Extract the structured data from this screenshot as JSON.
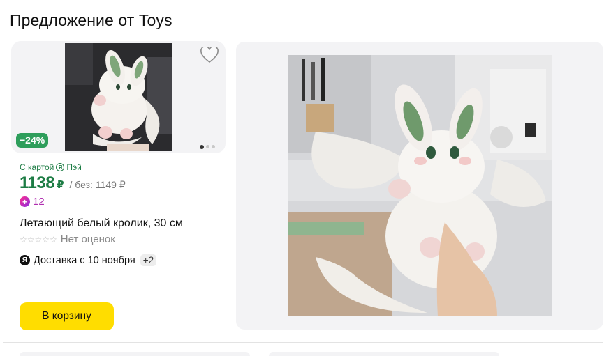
{
  "section": {
    "title": "Предложение от Toys"
  },
  "card": {
    "discount_badge": "−24%",
    "pay_label": "С картой",
    "pay_brand_mark": "Я",
    "pay_brand": "Пэй",
    "price": "1138",
    "currency": "₽",
    "old_price": "/ без: 1149 ₽",
    "plus_points": "12",
    "product_name": "Летающий белый кролик, 30 см",
    "stars": "☆☆☆☆☆",
    "rating_text": "Нет оценок",
    "delivery_mark": "Я",
    "delivery_text": "Доставка с 10 ноября",
    "delivery_more": "+2",
    "cart_button": "В корзину",
    "gallery": {
      "total": 3,
      "active": 1
    },
    "icons": {
      "favorite": "heart-outline-icon",
      "plus": "yandex-plus-icon"
    }
  },
  "colors": {
    "accent_green": "#1d7c44",
    "badge_green": "#2e9e5b",
    "cart_yellow": "#ffdd00",
    "plus_purple": "#b02fb0"
  }
}
